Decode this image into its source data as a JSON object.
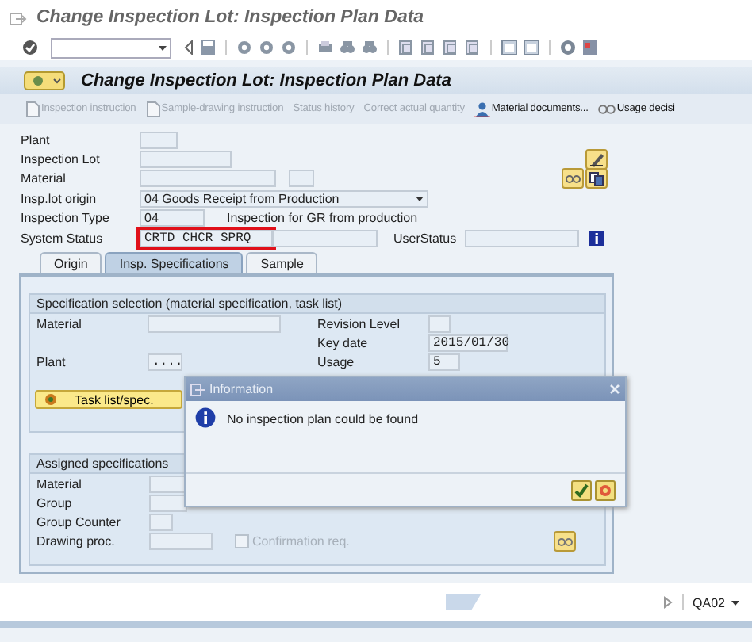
{
  "window": {
    "title": "Change Inspection Lot: Inspection Plan Data"
  },
  "screen_title": "Change Inspection Lot: Inspection Plan Data",
  "app_toolbar": [
    {
      "label": "Inspection instruction",
      "disabled": true
    },
    {
      "label": "Sample-drawing instruction",
      "disabled": true
    },
    {
      "label": "Status history",
      "disabled": true
    },
    {
      "label": "Correct actual quantity",
      "disabled": true
    },
    {
      "label": "Material documents...",
      "disabled": false
    },
    {
      "label": "Usage decisi",
      "disabled": false
    }
  ],
  "header_fields": [
    {
      "label": "Plant",
      "kind": "input"
    },
    {
      "label": "Inspection Lot",
      "kind": "input"
    },
    {
      "label": "Material",
      "kind": "input"
    },
    {
      "label": "Insp.lot origin",
      "kind": "dropdown",
      "value": "04 Goods Receipt from Production"
    },
    {
      "label": "Inspection Type",
      "kind": "input",
      "value": "04",
      "description": "Inspection for GR from production"
    },
    {
      "label": "System Status",
      "kind": "input",
      "value": "CRTD CHCR SPRQ",
      "highlighted": true,
      "side_label": "UserStatus"
    }
  ],
  "tabs": [
    {
      "label": "Origin",
      "selected": false
    },
    {
      "label": "Insp. Specifications",
      "selected": true
    },
    {
      "label": "Sample",
      "selected": false
    }
  ],
  "specification_selection": {
    "title": "Specification selection (material specification, task list)",
    "rows": [
      {
        "left": {
          "label": "Material"
        },
        "right": {
          "label": "Revision Level"
        }
      },
      {
        "right": {
          "label": "Key date",
          "value": "2015/01/30"
        }
      },
      {
        "left": {
          "label": "Plant",
          "value": "...."
        },
        "right": {
          "label": "Usage",
          "value": "5"
        }
      }
    ]
  },
  "task_list_button": "Task list/spec.",
  "assigned_specifications": {
    "title": "Assigned specifications",
    "fields": [
      {
        "label": "Material"
      },
      {
        "label": "Group"
      },
      {
        "label": "Group Counter"
      },
      {
        "label": "Drawing proc."
      }
    ],
    "checkbox": {
      "label": "Confirmation req.",
      "checked": false,
      "disabled": true
    }
  },
  "dialog": {
    "title": "Information",
    "message": "No inspection plan could be found"
  },
  "status_bar": {
    "system": "QA02"
  }
}
